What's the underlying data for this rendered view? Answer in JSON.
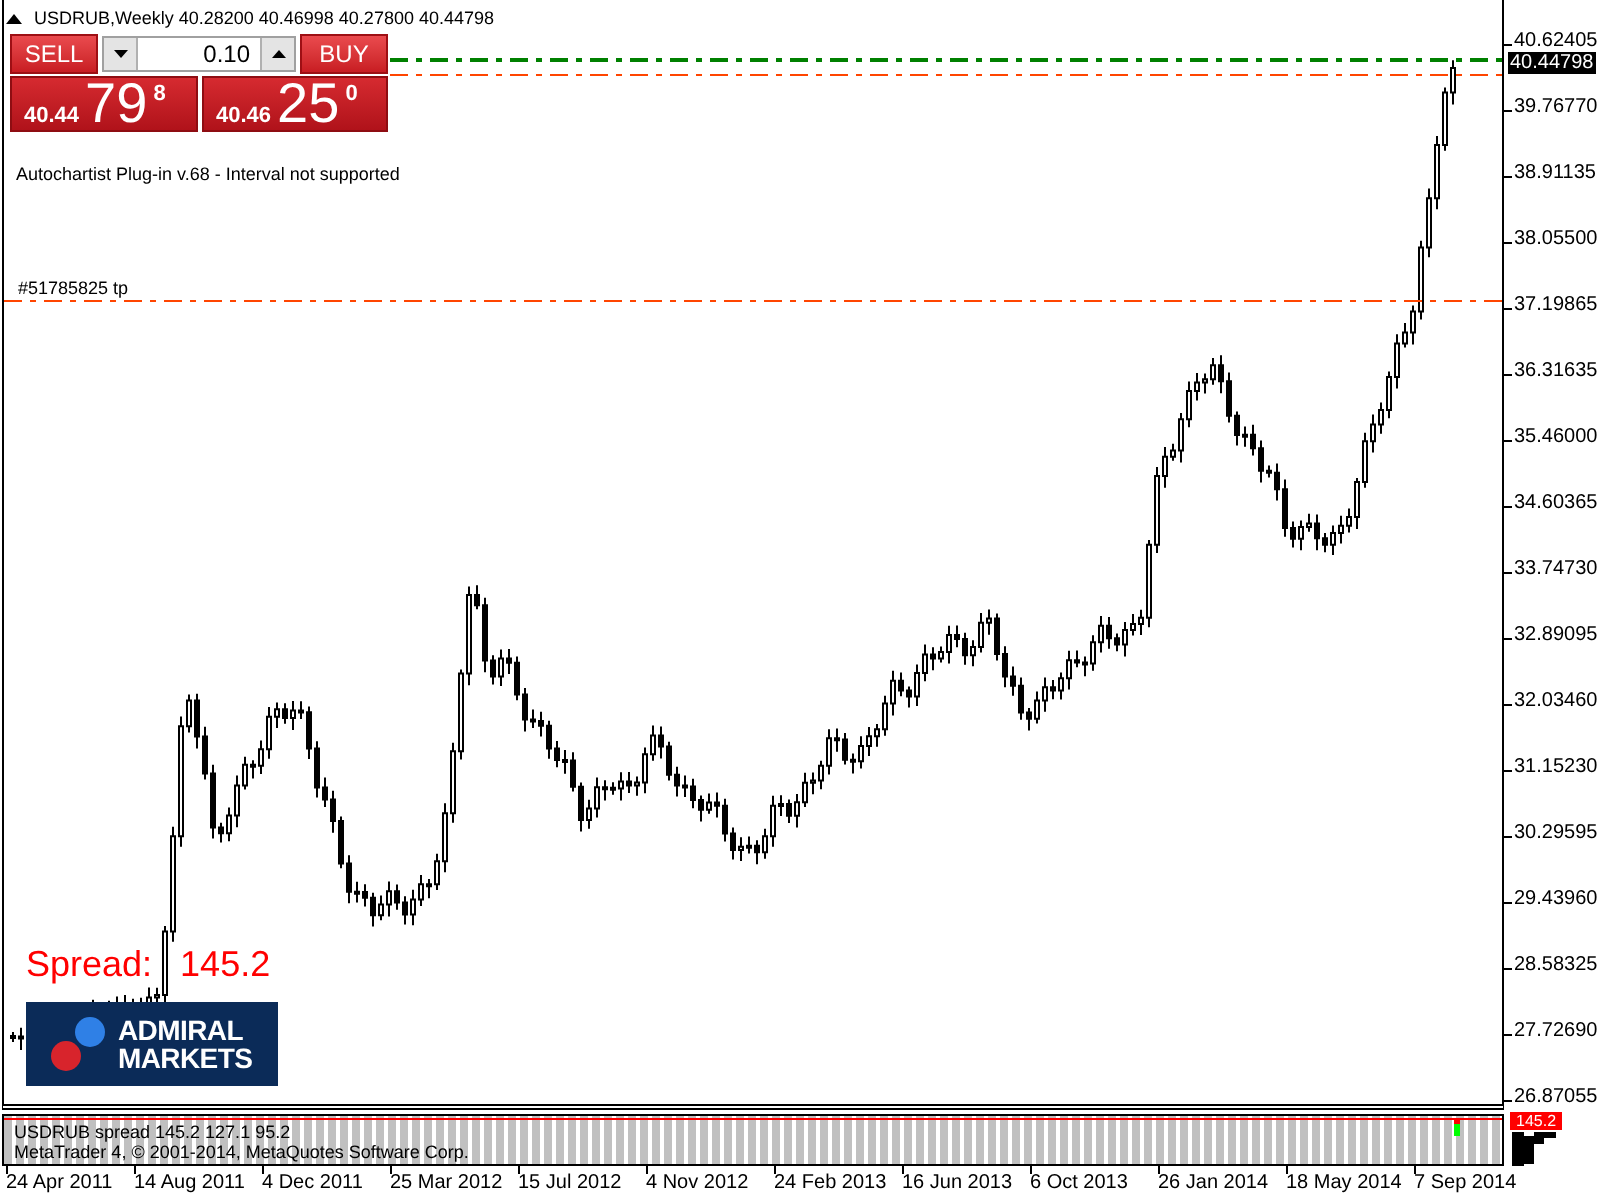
{
  "chart_title": "USDRUB,Weekly 40.28200 40.46998 40.27800 40.44798",
  "trading_panel": {
    "sell_label": "SELL",
    "lot": "0.10",
    "buy_label": "BUY",
    "sell_quote": {
      "big_figure": "40.44",
      "pips": "79",
      "point": "8"
    },
    "buy_quote": {
      "big_figure": "40.46",
      "pips": "25",
      "point": "0"
    }
  },
  "plugin_message": "Autochartist Plug-in v.68 - Interval not supported",
  "order_label": "#51785825 tp",
  "spread": {
    "label": "Spread:",
    "value": "145.2"
  },
  "logo": {
    "line_1": "ADMIRAL",
    "line_2": "MARKETS"
  },
  "price_axis": {
    "labels": [
      "40.62405",
      "39.76770",
      "38.91135",
      "38.05500",
      "37.19865",
      "36.31635",
      "35.46000",
      "34.60365",
      "33.74730",
      "32.89095",
      "32.03460",
      "31.15230",
      "30.29595",
      "29.43960",
      "28.58325",
      "27.72690",
      "26.87055"
    ],
    "current_price": "40.44798"
  },
  "indicator": {
    "caption": "USDRUB spread 145.2 127.1 95.2",
    "copyright": "MetaTrader 4, © 2001-2014, MetaQuotes Software Corp.",
    "value_label": "145.2"
  },
  "time_axis": {
    "labels": [
      "24 Apr 2011",
      "14 Aug 2011",
      "4 Dec 2011",
      "25 Mar 2012",
      "15 Jul 2012",
      "4 Nov 2012",
      "24 Feb 2013",
      "16 Jun 2013",
      "6 Oct 2013",
      "26 Jan 2014",
      "18 May 2014",
      "7 Sep 2014"
    ]
  }
}
